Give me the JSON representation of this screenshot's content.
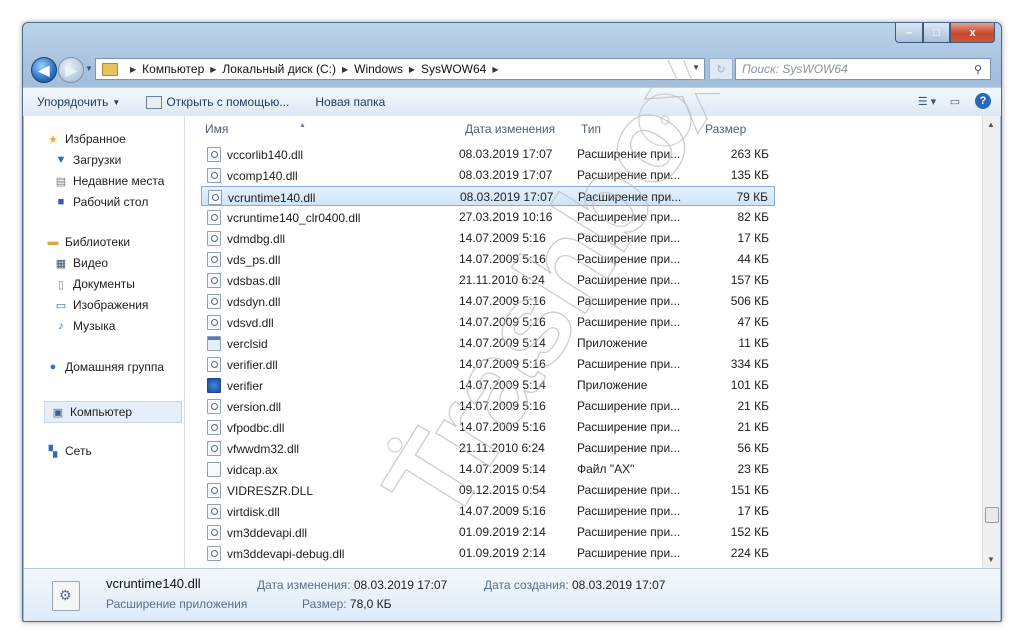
{
  "window": {
    "caption_buttons": {
      "minimize": "–",
      "maximize": "□",
      "close": "x"
    }
  },
  "address": {
    "crumbs": [
      "Компьютер",
      "Локальный диск (C:)",
      "Windows",
      "SysWOW64"
    ],
    "search_placeholder": "Поиск: SysWOW64"
  },
  "toolbar": {
    "organize": "Упорядочить",
    "open_with": "Открыть с помощью...",
    "new_folder": "Новая папка"
  },
  "nav": {
    "favorites": "Избранное",
    "downloads": "Загрузки",
    "recent": "Недавние места",
    "desktop": "Рабочий стол",
    "libraries": "Библиотеки",
    "video": "Видео",
    "documents": "Документы",
    "images": "Изображения",
    "music": "Музыка",
    "homegroup": "Домашняя группа",
    "computer": "Компьютер",
    "network": "Сеть"
  },
  "columns": {
    "name": "Имя",
    "date": "Дата изменения",
    "type": "Тип",
    "size": "Размер"
  },
  "files": [
    {
      "name": "vccorlib140.dll",
      "date": "08.03.2019 17:07",
      "type": "Расширение при...",
      "size": "263 КБ",
      "icon": "dll"
    },
    {
      "name": "vcomp140.dll",
      "date": "08.03.2019 17:07",
      "type": "Расширение при...",
      "size": "135 КБ",
      "icon": "dll"
    },
    {
      "name": "vcruntime140.dll",
      "date": "08.03.2019 17:07",
      "type": "Расширение при...",
      "size": "79 КБ",
      "icon": "dll",
      "selected": true
    },
    {
      "name": "vcruntime140_clr0400.dll",
      "date": "27.03.2019 10:16",
      "type": "Расширение при...",
      "size": "82 КБ",
      "icon": "dll"
    },
    {
      "name": "vdmdbg.dll",
      "date": "14.07.2009 5:16",
      "type": "Расширение при...",
      "size": "17 КБ",
      "icon": "dll"
    },
    {
      "name": "vds_ps.dll",
      "date": "14.07.2009 5:16",
      "type": "Расширение при...",
      "size": "44 КБ",
      "icon": "dll"
    },
    {
      "name": "vdsbas.dll",
      "date": "21.11.2010 6:24",
      "type": "Расширение при...",
      "size": "157 КБ",
      "icon": "dll"
    },
    {
      "name": "vdsdyn.dll",
      "date": "14.07.2009 5:16",
      "type": "Расширение при...",
      "size": "506 КБ",
      "icon": "dll"
    },
    {
      "name": "vdsvd.dll",
      "date": "14.07.2009 5:16",
      "type": "Расширение при...",
      "size": "47 КБ",
      "icon": "dll"
    },
    {
      "name": "verclsid",
      "date": "14.07.2009 5:14",
      "type": "Приложение",
      "size": "11 КБ",
      "icon": "app"
    },
    {
      "name": "verifier.dll",
      "date": "14.07.2009 5:16",
      "type": "Расширение при...",
      "size": "334 КБ",
      "icon": "dll"
    },
    {
      "name": "verifier",
      "date": "14.07.2009 5:14",
      "type": "Приложение",
      "size": "101 КБ",
      "icon": "verifier"
    },
    {
      "name": "version.dll",
      "date": "14.07.2009 5:16",
      "type": "Расширение при...",
      "size": "21 КБ",
      "icon": "dll"
    },
    {
      "name": "vfpodbc.dll",
      "date": "14.07.2009 5:16",
      "type": "Расширение при...",
      "size": "21 КБ",
      "icon": "dll"
    },
    {
      "name": "vfwwdm32.dll",
      "date": "21.11.2010 6:24",
      "type": "Расширение при...",
      "size": "56 КБ",
      "icon": "dll"
    },
    {
      "name": "vidcap.ax",
      "date": "14.07.2009 5:14",
      "type": "Файл \"AX\"",
      "size": "23 КБ",
      "icon": "blank"
    },
    {
      "name": "VIDRESZR.DLL",
      "date": "09.12.2015 0:54",
      "type": "Расширение при...",
      "size": "151 КБ",
      "icon": "dll"
    },
    {
      "name": "virtdisk.dll",
      "date": "14.07.2009 5:16",
      "type": "Расширение при...",
      "size": "17 КБ",
      "icon": "dll"
    },
    {
      "name": "vm3ddevapi.dll",
      "date": "01.09.2019 2:14",
      "type": "Расширение при...",
      "size": "152 КБ",
      "icon": "dll"
    },
    {
      "name": "vm3ddevapi-debug.dll",
      "date": "01.09.2019 2:14",
      "type": "Расширение при...",
      "size": "224 КБ",
      "icon": "dll"
    }
  ],
  "details": {
    "filename": "vcruntime140.dll",
    "filetype": "Расширение приложения",
    "modified_label": "Дата изменения:",
    "modified_value": "08.03.2019 17:07",
    "created_label": "Дата создания:",
    "created_value": "08.03.2019 17:07",
    "size_label": "Размер:",
    "size_value": "78,0 КБ"
  },
  "watermark": {
    "text": "Trashbox"
  }
}
